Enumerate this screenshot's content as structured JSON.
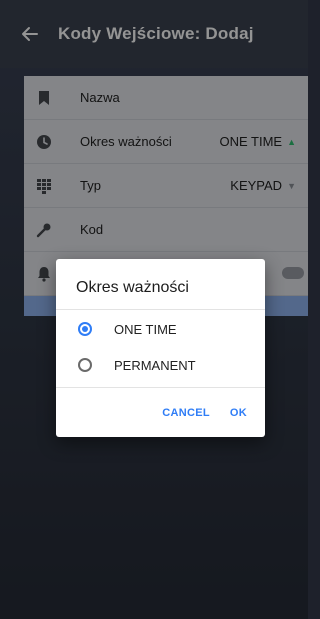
{
  "appbar": {
    "back_icon": "arrow-left-icon",
    "title": "Kody Wejściowe: Dodaj"
  },
  "form": {
    "rows": [
      {
        "icon": "bookmark-icon",
        "label": "Nazwa",
        "value": ""
      },
      {
        "icon": "clock-icon",
        "label": "Okres ważności",
        "value": "ONE TIME",
        "indicator": "▲",
        "indicator_color": "#2fbf71"
      },
      {
        "icon": "keypad-icon",
        "label": "Typ",
        "value": "KEYPAD",
        "indicator": "▼",
        "indicator_color": "#8a8f97"
      },
      {
        "icon": "key-icon",
        "label": "Kod",
        "value": ""
      },
      {
        "icon": "bell-icon",
        "label": "",
        "value": ""
      }
    ]
  },
  "dialog": {
    "title": "Okres ważności",
    "options": [
      {
        "label": "ONE TIME",
        "selected": true
      },
      {
        "label": "PERMANENT",
        "selected": false
      }
    ],
    "cancel_label": "CANCEL",
    "ok_label": "OK"
  },
  "colors": {
    "accent": "#2f7df6",
    "appbar": "#3b4250",
    "row_bg": "#e3e6eb"
  }
}
